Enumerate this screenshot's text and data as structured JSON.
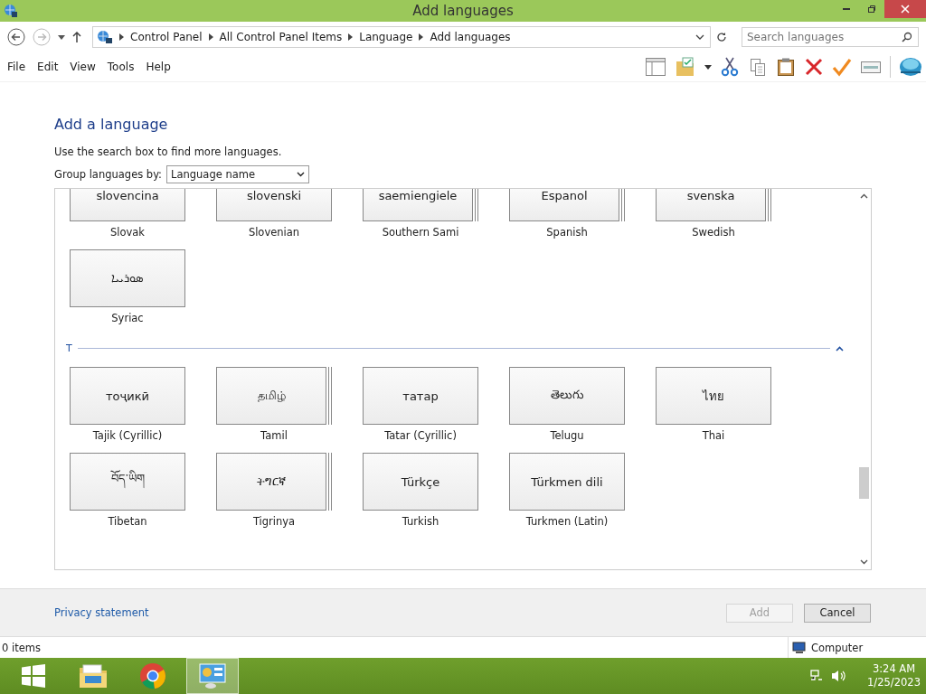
{
  "window": {
    "title": "Add languages"
  },
  "address": {
    "crumbs": [
      "Control Panel",
      "All Control Panel Items",
      "Language",
      "Add languages"
    ],
    "search_placeholder": "Search languages"
  },
  "menu": [
    "File",
    "Edit",
    "View",
    "Tools",
    "Help"
  ],
  "heading": "Add a language",
  "instructions": "Use the search box to find more languages.",
  "group_by": {
    "label": "Group languages by:",
    "value": "Language name"
  },
  "groups": [
    {
      "tiles": [
        {
          "native": "slovencina",
          "name": "Slovak",
          "stacked": false
        },
        {
          "native": "slovenski",
          "name": "Slovenian",
          "stacked": false
        },
        {
          "native": "saemiengiele",
          "name": "Southern Sami",
          "stacked": true
        },
        {
          "native": "Espanol",
          "name": "Spanish",
          "stacked": true
        },
        {
          "native": "svenska",
          "name": "Swedish",
          "stacked": true
        },
        {
          "native": "ܣܘܪܝܝܐ",
          "name": "Syriac",
          "stacked": false
        }
      ]
    },
    {
      "letter": "T",
      "expanded": true,
      "tiles": [
        {
          "native": "тоҷикӣ",
          "name": "Tajik (Cyrillic)",
          "stacked": false
        },
        {
          "native": "தமிழ்",
          "name": "Tamil",
          "stacked": true
        },
        {
          "native": "татар",
          "name": "Tatar (Cyrillic)",
          "stacked": false
        },
        {
          "native": "తెలుగు",
          "name": "Telugu",
          "stacked": false
        },
        {
          "native": "ไทย",
          "name": "Thai",
          "stacked": false
        },
        {
          "native": "བོད་ཡིག",
          "name": "Tibetan",
          "stacked": false
        },
        {
          "native": "ትግርኛ",
          "name": "Tigrinya",
          "stacked": true
        },
        {
          "native": "Türkçe",
          "name": "Turkish",
          "stacked": false
        },
        {
          "native": "Türkmen dili",
          "name": "Turkmen (Latin)",
          "stacked": false
        }
      ]
    }
  ],
  "footer": {
    "link": "Privacy statement",
    "buttons": [
      {
        "label": "Add",
        "disabled": true
      },
      {
        "label": "Cancel",
        "disabled": false
      }
    ]
  },
  "status": {
    "items": "0 items",
    "zone": "Computer"
  },
  "clock": {
    "time": "3:24 AM",
    "date": "1/25/2023"
  }
}
